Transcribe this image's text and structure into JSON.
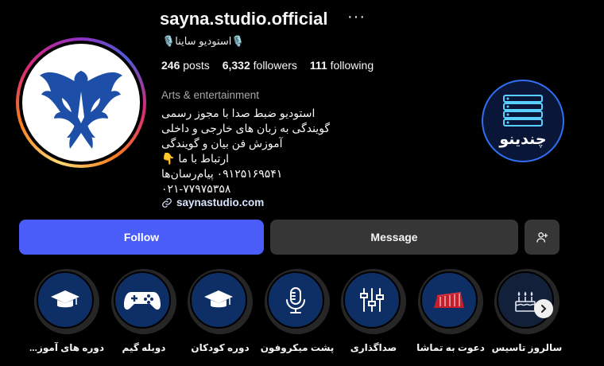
{
  "profile": {
    "username": "sayna.studio.official",
    "full_name": "🎙️استودیو ساینا🎙️",
    "stats": {
      "posts_count": "246",
      "posts_label": "posts",
      "followers_count": "6,332",
      "followers_label": "followers",
      "following_count": "111",
      "following_label": "following"
    },
    "category": "Arts & entertainment",
    "bio_lines": [
      "استودیو ضبط صدا با مجوز رسمی",
      "گویندگی به زبان های خارجی و داخلی",
      "آموزش فن بیان و گویندگی",
      "ارتباط با ما 👇",
      "۰۹۱۲۵۱۶۹۵۴۱ پیام‌رسان‌ها",
      "۰۲۱-۷۷۹۷۵۳۵۸"
    ],
    "link": "saynastudio.com"
  },
  "actions": {
    "follow_label": "Follow",
    "message_label": "Message"
  },
  "highlights": [
    {
      "label": "سالروز تاسیس",
      "icon": "birthday-cake-icon"
    },
    {
      "label": "دعوت به تماشا",
      "icon": "stage-icon"
    },
    {
      "label": "صداگذاری",
      "icon": "mixer-sliders-icon"
    },
    {
      "label": "پشت میکروفون",
      "icon": "microphone-icon"
    },
    {
      "label": "دوره کودکان",
      "icon": "graduation-cap-icon"
    },
    {
      "label": "دوبله گیم",
      "icon": "gamepad-icon"
    },
    {
      "label": "دوره های آموز...",
      "icon": "graduation-cap-icon"
    }
  ],
  "badge_logo_text": "چندینو",
  "colors": {
    "follow_button": "#4a5df9",
    "secondary_button": "#363636",
    "highlight_bg": "#0d2f66",
    "logo_blue": "#1e4fa8"
  }
}
